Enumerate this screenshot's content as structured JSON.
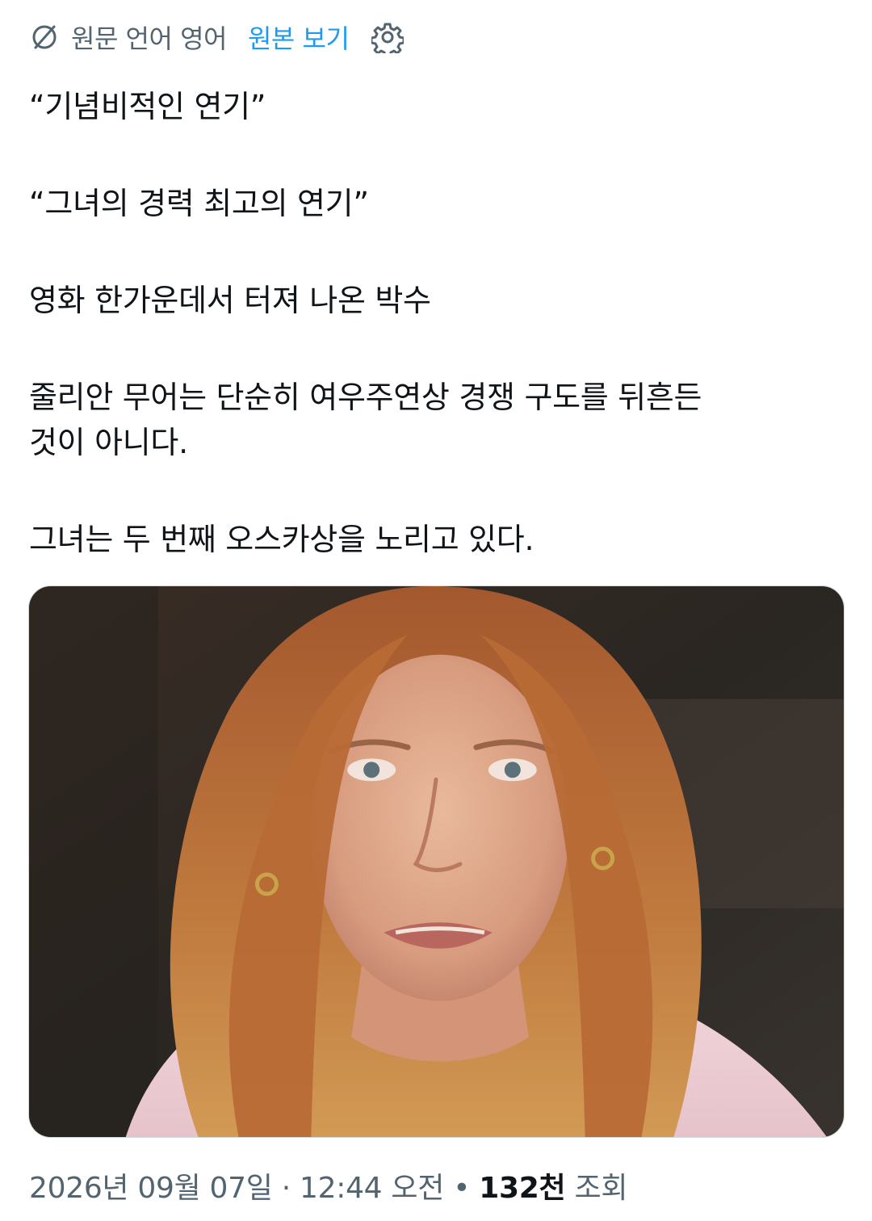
{
  "translate_bar": {
    "icon": "translate-globe-icon",
    "source_language_text": "원문 언어 영어",
    "show_original_label": "원본 보기",
    "settings_icon": "gear-icon",
    "link_color": "#1d9bf0"
  },
  "tweet": {
    "paragraphs": [
      "“기념비적인 연기”",
      "“그녀의 경력 최고의 연기”",
      "영화 한가운데서 터져 나온 박수",
      "줄리안 무어는 단순히 여우주연상 경쟁 구도를 뒤흔든",
      "것이 아니다.",
      "그녀는 두 번째 오스카상을 노리고 있다."
    ]
  },
  "media": {
    "type": "photo",
    "subject": "woman with auburn hair, tearful expression, gold hoop earrings, pink sweater"
  },
  "footer": {
    "date": "2026년 09월 07일",
    "separator_dot": " · ",
    "time": "12:44 오전",
    "bullet": " • ",
    "views_count": "132천",
    "views_label": " 조회"
  }
}
